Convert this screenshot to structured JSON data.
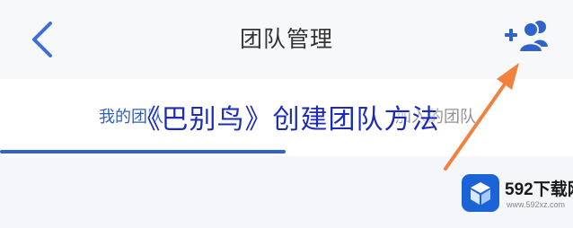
{
  "header": {
    "title": "团队管理",
    "back_icon": "chevron-left-icon",
    "add_icon": "add-member-icon"
  },
  "tabs": [
    {
      "label": "我的团队",
      "active": true
    },
    {
      "label": "加入的团队",
      "active": false
    }
  ],
  "overlay_caption": "《巴别鸟》创建团队方法",
  "watermark": {
    "title": "592下载网",
    "url": "www.592xz.com"
  },
  "colors": {
    "accent": "#2f63c9",
    "arrow": "#f0823e",
    "caption": "#1c2cb8",
    "logo": "#1b64d8"
  }
}
